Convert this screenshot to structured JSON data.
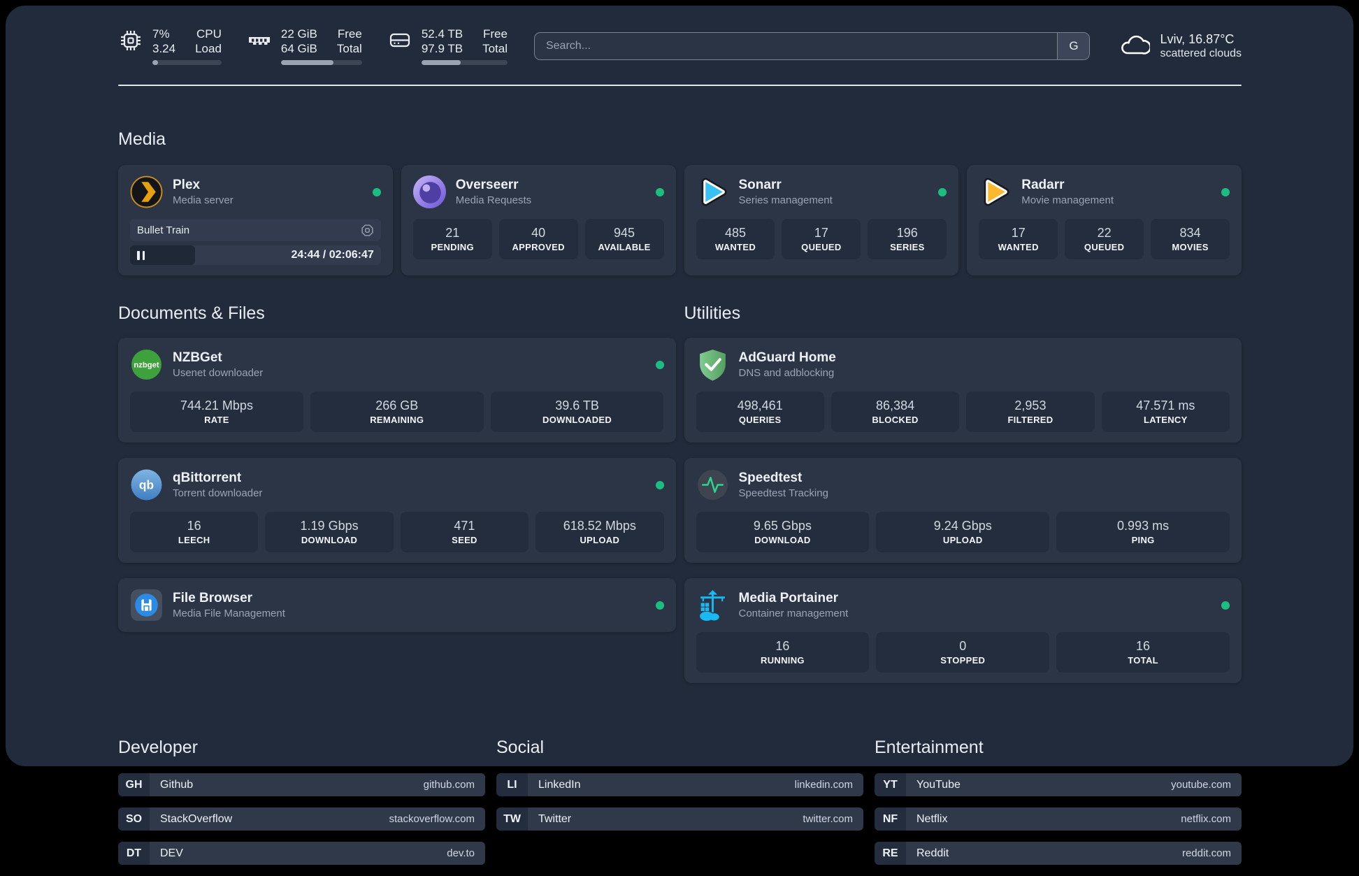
{
  "header": {
    "stats": [
      {
        "name": "cpu",
        "values": [
          "7%",
          "3.24"
        ],
        "labels": [
          "CPU",
          "Load"
        ],
        "progress_pct": 8
      },
      {
        "name": "memory",
        "values": [
          "22 GiB",
          "64 GiB"
        ],
        "labels": [
          "Free",
          "Total"
        ],
        "progress_pct": 65
      },
      {
        "name": "storage",
        "values": [
          "52.4 TB",
          "97.9 TB"
        ],
        "labels": [
          "Free",
          "Total"
        ],
        "progress_pct": 46
      }
    ],
    "search": {
      "placeholder": "Search...",
      "provider_button": "G"
    },
    "weather": {
      "headline": "Lviv, 16.87°C",
      "description": "scattered clouds"
    }
  },
  "media": {
    "title": "Media",
    "apps": [
      {
        "name": "Plex",
        "subtitle": "Media server",
        "online": true,
        "now_playing": {
          "title": "Bullet Train",
          "time": "24:44 / 02:06:47",
          "progress_pct": 26
        }
      },
      {
        "name": "Overseerr",
        "subtitle": "Media Requests",
        "online": true,
        "stats": [
          {
            "value": "21",
            "label": "PENDING"
          },
          {
            "value": "40",
            "label": "APPROVED"
          },
          {
            "value": "945",
            "label": "AVAILABLE"
          }
        ]
      },
      {
        "name": "Sonarr",
        "subtitle": "Series management",
        "online": true,
        "stats": [
          {
            "value": "485",
            "label": "WANTED"
          },
          {
            "value": "17",
            "label": "QUEUED"
          },
          {
            "value": "196",
            "label": "SERIES"
          }
        ]
      },
      {
        "name": "Radarr",
        "subtitle": "Movie management",
        "online": true,
        "stats": [
          {
            "value": "17",
            "label": "WANTED"
          },
          {
            "value": "22",
            "label": "QUEUED"
          },
          {
            "value": "834",
            "label": "MOVIES"
          }
        ]
      }
    ]
  },
  "documents": {
    "title": "Documents & Files",
    "apps": [
      {
        "name": "NZBGet",
        "subtitle": "Usenet downloader",
        "online": true,
        "stats": [
          {
            "value": "744.21 Mbps",
            "label": "RATE"
          },
          {
            "value": "266 GB",
            "label": "REMAINING"
          },
          {
            "value": "39.6 TB",
            "label": "DOWNLOADED"
          }
        ]
      },
      {
        "name": "qBittorrent",
        "subtitle": "Torrent downloader",
        "online": true,
        "stats": [
          {
            "value": "16",
            "label": "LEECH"
          },
          {
            "value": "1.19 Gbps",
            "label": "DOWNLOAD"
          },
          {
            "value": "471",
            "label": "SEED"
          },
          {
            "value": "618.52 Mbps",
            "label": "UPLOAD"
          }
        ]
      },
      {
        "name": "File Browser",
        "subtitle": "Media File Management",
        "online": true
      }
    ]
  },
  "utilities": {
    "title": "Utilities",
    "apps": [
      {
        "name": "AdGuard Home",
        "subtitle": "DNS and adblocking",
        "stats": [
          {
            "value": "498,461",
            "label": "QUERIES"
          },
          {
            "value": "86,384",
            "label": "BLOCKED"
          },
          {
            "value": "2,953",
            "label": "FILTERED"
          },
          {
            "value": "47.571 ms",
            "label": "LATENCY"
          }
        ]
      },
      {
        "name": "Speedtest",
        "subtitle": "Speedtest Tracking",
        "stats": [
          {
            "value": "9.65 Gbps",
            "label": "DOWNLOAD"
          },
          {
            "value": "9.24 Gbps",
            "label": "UPLOAD"
          },
          {
            "value": "0.993 ms",
            "label": "PING"
          }
        ]
      },
      {
        "name": "Media Portainer",
        "subtitle": "Container management",
        "online": true,
        "stats": [
          {
            "value": "16",
            "label": "RUNNING"
          },
          {
            "value": "0",
            "label": "STOPPED"
          },
          {
            "value": "16",
            "label": "TOTAL"
          }
        ]
      }
    ]
  },
  "link_sections": [
    {
      "title": "Developer",
      "links": [
        {
          "tag": "GH",
          "name": "Github",
          "url": "github.com"
        },
        {
          "tag": "SO",
          "name": "StackOverflow",
          "url": "stackoverflow.com"
        },
        {
          "tag": "DT",
          "name": "DEV",
          "url": "dev.to"
        }
      ]
    },
    {
      "title": "Social",
      "links": [
        {
          "tag": "LI",
          "name": "LinkedIn",
          "url": "linkedin.com"
        },
        {
          "tag": "TW",
          "name": "Twitter",
          "url": "twitter.com"
        }
      ]
    },
    {
      "title": "Entertainment",
      "links": [
        {
          "tag": "YT",
          "name": "YouTube",
          "url": "youtube.com"
        },
        {
          "tag": "NF",
          "name": "Netflix",
          "url": "netflix.com"
        },
        {
          "tag": "RE",
          "name": "Reddit",
          "url": "reddit.com"
        }
      ]
    }
  ]
}
